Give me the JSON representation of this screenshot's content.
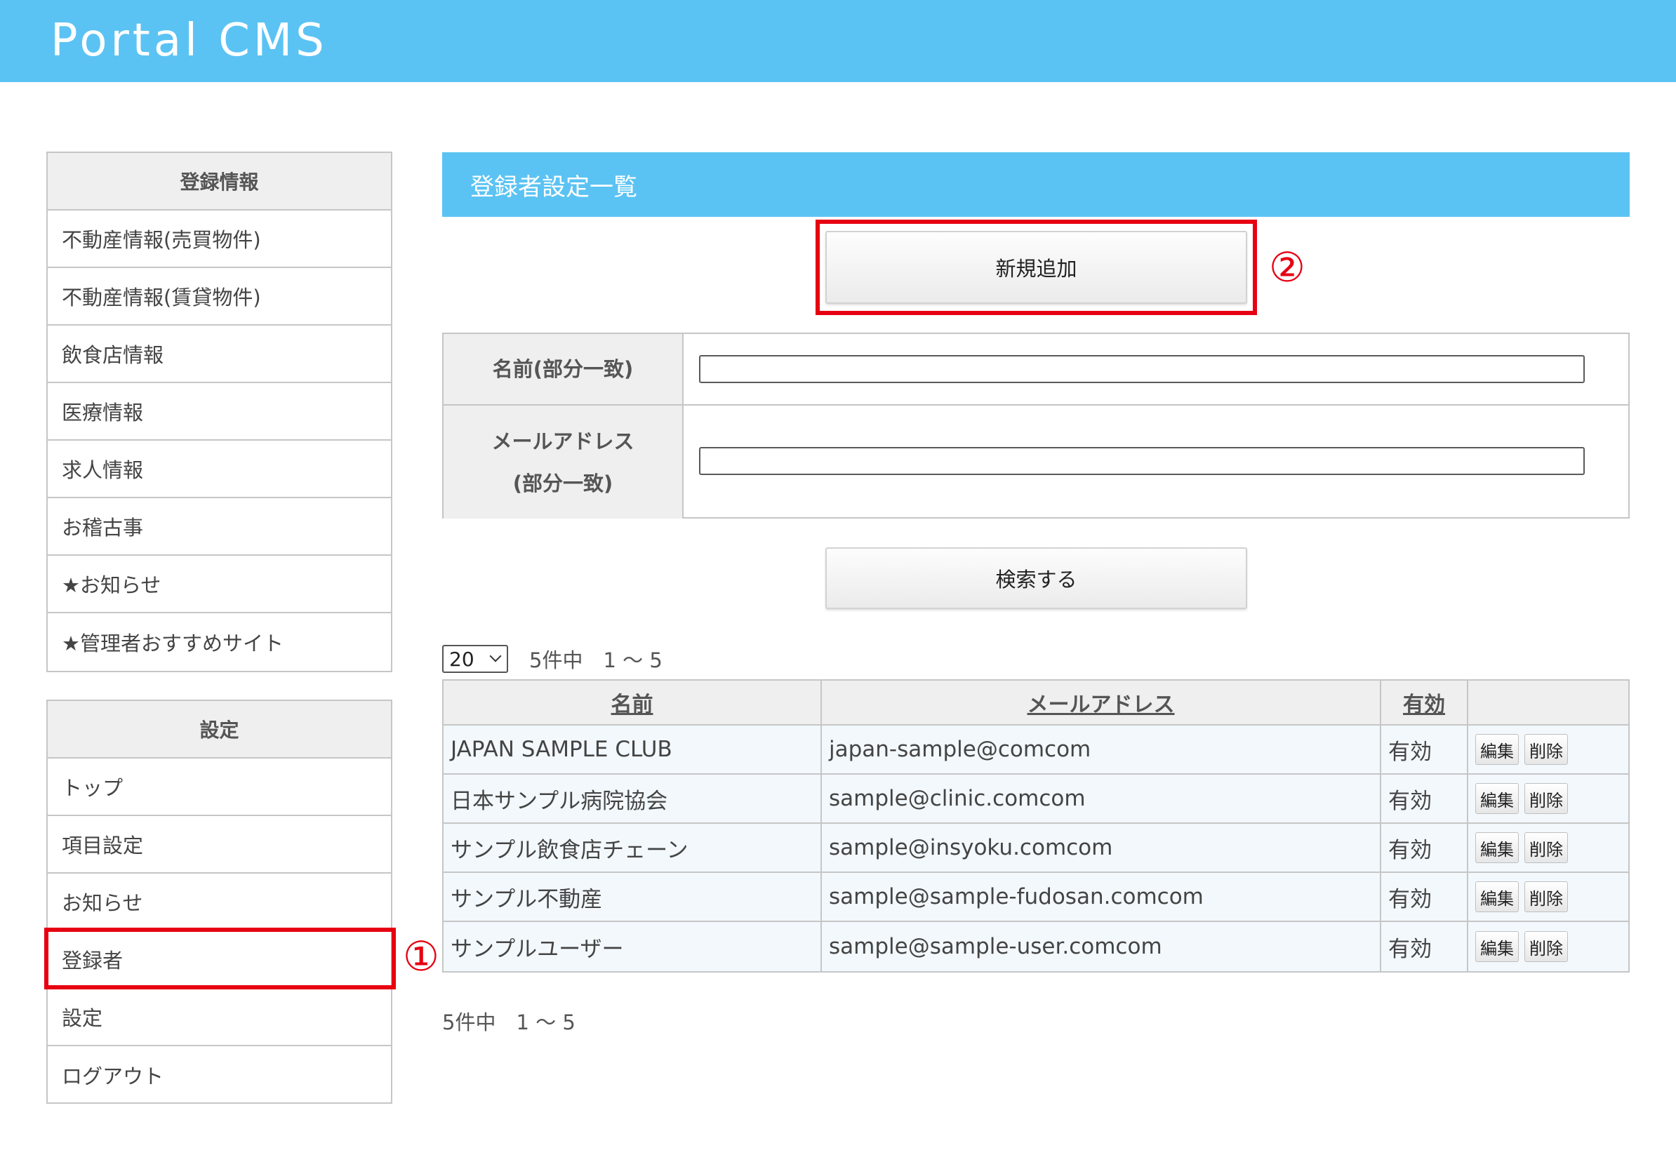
{
  "app": {
    "title": "Portal CMS"
  },
  "sidebar": {
    "group1": {
      "heading": "登録情報",
      "items": [
        "不動産情報(売買物件)",
        "不動産情報(賃貸物件)",
        "飲食店情報",
        "医療情報",
        "求人情報",
        "お稽古事",
        "★お知らせ",
        "★管理者おすすめサイト"
      ]
    },
    "group2": {
      "heading": "設定",
      "items": [
        "トップ",
        "項目設定",
        "お知らせ",
        "登録者",
        "設定",
        "ログアウト"
      ]
    }
  },
  "annotations": {
    "marker1": "①",
    "marker2": "②"
  },
  "main": {
    "section_title": "登録者設定一覧",
    "add_button": "新規追加",
    "search": {
      "name_label": "名前(部分一致)",
      "email_label_line1": "メールアドレス",
      "email_label_line2": "(部分一致)",
      "name_value": "",
      "email_value": "",
      "submit": "検索する"
    },
    "pager": {
      "per_page": "20",
      "summary": "5件中　1 〜 5"
    },
    "table": {
      "headers": [
        "名前",
        "メールアドレス",
        "有効"
      ],
      "edit_label": "編集",
      "delete_label": "削除",
      "rows": [
        {
          "name": "JAPAN SAMPLE CLUB",
          "email": "japan-sample@comcom",
          "status": "有効"
        },
        {
          "name": "日本サンプル病院協会",
          "email": "sample@clinic.comcom",
          "status": "有効"
        },
        {
          "name": "サンプル飲食店チェーン",
          "email": "sample@insyoku.comcom",
          "status": "有効"
        },
        {
          "name": "サンプル不動産",
          "email": "sample@sample-fudosan.comcom",
          "status": "有効"
        },
        {
          "name": "サンプルユーザー",
          "email": "sample@sample-user.comcom",
          "status": "有効"
        }
      ]
    },
    "footer_summary": "5件中　1 〜 5"
  }
}
